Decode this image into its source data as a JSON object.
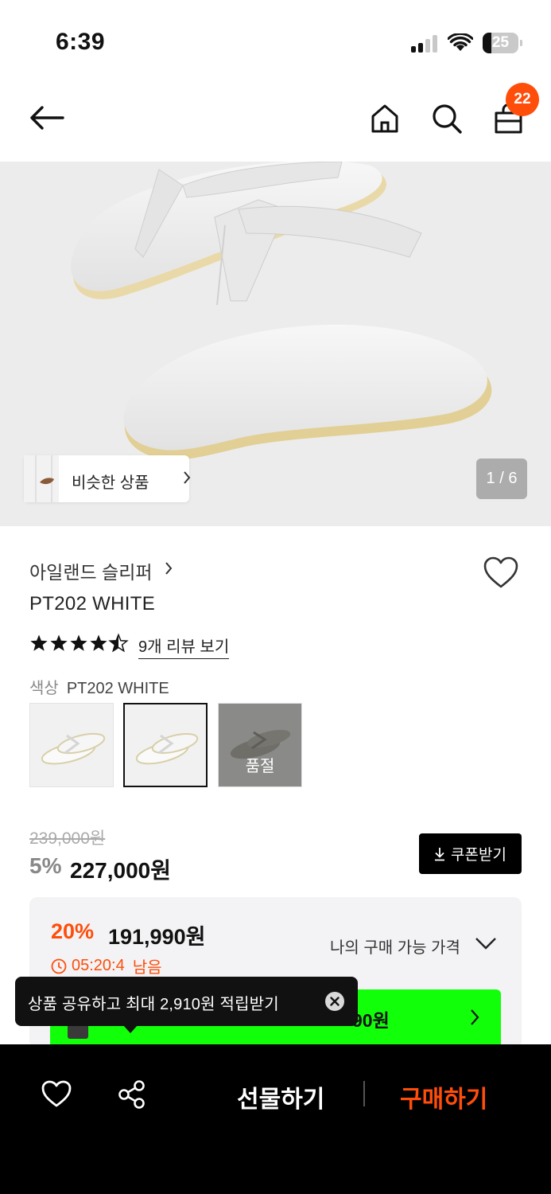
{
  "status_bar": {
    "time": "6:39",
    "battery_percent": "25",
    "battery_level": 0.25
  },
  "nav": {
    "cart_count": "22",
    "icons": [
      "back-arrow-icon",
      "home-icon",
      "search-icon",
      "cart-icon"
    ]
  },
  "hero": {
    "similar_label": "비슷한 상품",
    "pager": "1 / 6"
  },
  "product": {
    "brand": "아일랜드 슬리퍼",
    "name": "PT202 WHITE",
    "rating_stars": 4.5,
    "review_link": "9개 리뷰 보기",
    "color_label": "색상",
    "color_value": "PT202 WHITE",
    "swatches": [
      {
        "name": "white-variant-1",
        "selected": false,
        "sold_out": false
      },
      {
        "name": "white-variant-2",
        "selected": true,
        "sold_out": false
      },
      {
        "name": "gray-variant",
        "selected": false,
        "sold_out": true,
        "label": "품절"
      }
    ]
  },
  "pricing": {
    "original_price": "239,000원",
    "discount_rate": "5%",
    "sale_price": "227,000원",
    "coupon_button": "쿠폰받기",
    "best_rate": "20%",
    "best_price": "191,990원",
    "timer": "05:20:4",
    "timer_suffix": "남음",
    "my_price_label": "나의 구매 가능 가격",
    "green_price_partial": "90원"
  },
  "tooltip": {
    "text": "상품 공유하고 최대 2,910원 적립받기"
  },
  "bottom_bar": {
    "gift_label": "선물하기",
    "buy_label": "구매하기"
  },
  "colors": {
    "accent": "#ff4d0a",
    "green": "#12ff0a",
    "hero_bg": "#ececec"
  }
}
